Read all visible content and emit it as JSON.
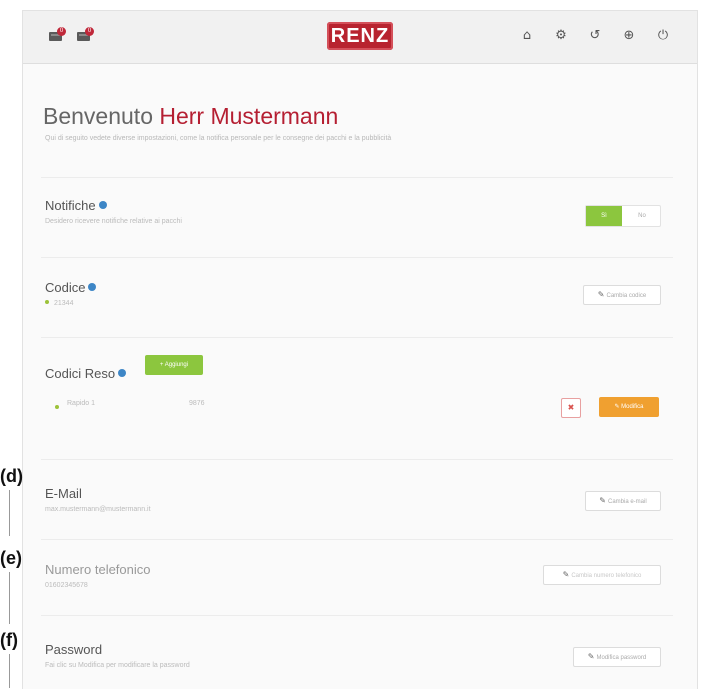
{
  "header": {
    "logo_text": "RENZ",
    "mail_badges": [
      "0",
      "0"
    ],
    "icons": [
      "home-icon",
      "gear-icon",
      "history-icon",
      "globe-icon",
      "power-icon"
    ]
  },
  "welcome": {
    "greeting": "Benvenuto",
    "name": "Herr Mustermann",
    "subtitle": "Qui di seguito vedete diverse impostazioni, come la notifica personale per le consegne dei pacchi e la pubblicità"
  },
  "notifiche": {
    "title": "Notifiche",
    "subtitle": "Desidero ricevere notifiche relative ai pacchi",
    "toggle_on": "Sì",
    "toggle_off": "No"
  },
  "codice": {
    "title": "Codice",
    "value": "21344",
    "button": "Cambia codice"
  },
  "codici_reso": {
    "title": "Codici Reso",
    "add_button": "Aggiungi",
    "row_label": "Rapido 1",
    "row_value": "9876",
    "delete_button": "✖",
    "modify_button": "Modifica"
  },
  "email": {
    "title": "E-Mail",
    "value": "max.mustermann@mustermann.it",
    "button": "Cambia e-mail"
  },
  "telefono": {
    "title": "Numero telefonico",
    "value": "01602345678",
    "button": "Cambia numero telefonico"
  },
  "password": {
    "title": "Password",
    "subtitle": "Fai clic su Modifica per modificare la password",
    "button": "Modifica password"
  },
  "side_labels": {
    "d": "(d)",
    "e": "(e)",
    "f": "(f)"
  },
  "colors": {
    "brand_red": "#b8232f",
    "green": "#8cc63e",
    "orange": "#f0a030",
    "info_blue": "#3d86c6"
  }
}
